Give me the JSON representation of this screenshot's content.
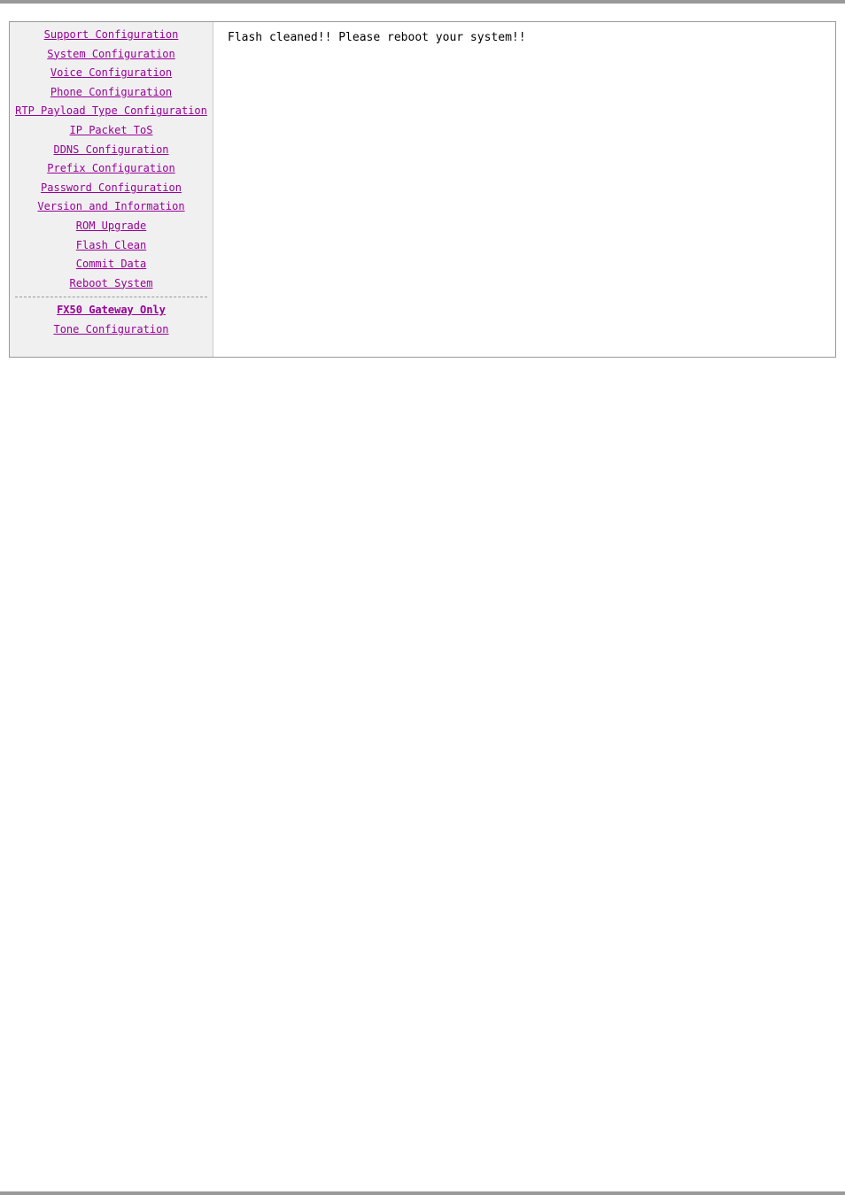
{
  "layout": {
    "main_content": "Flash cleaned!! Please reboot your system!!"
  },
  "sidebar": {
    "items": [
      {
        "id": "support-config",
        "label": "Support\nConfiguration"
      },
      {
        "id": "system-config",
        "label": "System\nConfiguration"
      },
      {
        "id": "voice-config",
        "label": "Voice\nConfiguration"
      },
      {
        "id": "phone-config",
        "label": "Phone\nConfiguration"
      },
      {
        "id": "rtp-payload",
        "label": "RTP Payload Type\nConfiguration"
      },
      {
        "id": "ip-packet-tos",
        "label": "IP Packet ToS"
      },
      {
        "id": "ddns-config",
        "label": "DDNS\nConfiguration"
      },
      {
        "id": "prefix-config",
        "label": "Prefix\nConfiguration"
      },
      {
        "id": "password-config",
        "label": "Password\nConfiguration"
      },
      {
        "id": "version-info",
        "label": "Version and\nInformation"
      },
      {
        "id": "rom-upgrade",
        "label": "ROM Upgrade"
      },
      {
        "id": "flash-clean",
        "label": "Flash Clean"
      },
      {
        "id": "commit-data",
        "label": "Commit Data"
      },
      {
        "id": "reboot-system",
        "label": "Reboot System"
      }
    ],
    "divider": true,
    "section_items": [
      {
        "id": "fx50-gateway",
        "label": "FX50 Gateway\nOnly"
      },
      {
        "id": "tone-config",
        "label": "Tone\nConfiguration"
      }
    ]
  }
}
